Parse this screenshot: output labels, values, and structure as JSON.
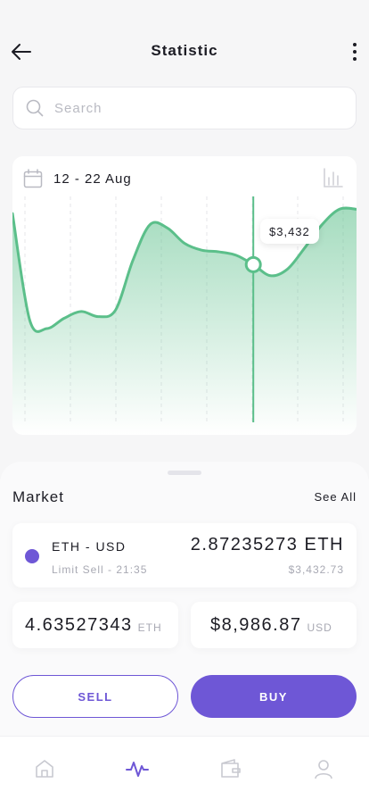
{
  "header": {
    "title": "Statistic"
  },
  "search": {
    "placeholder": "Search",
    "value": ""
  },
  "chart": {
    "date_range": "12 - 22 Aug",
    "tooltip": "$3,432",
    "accent": "#5bbf8a",
    "icons": {
      "calendar": "calendar-icon",
      "chart_type": "bar-chart-icon"
    }
  },
  "chart_data": {
    "type": "area",
    "x": [
      0,
      1,
      2,
      3,
      4,
      5,
      6,
      7,
      8,
      9,
      10,
      11,
      12,
      13,
      14,
      15,
      16,
      17,
      18,
      19,
      20
    ],
    "values": [
      245,
      120,
      110,
      122,
      130,
      124,
      132,
      190,
      232,
      228,
      210,
      202,
      200,
      196,
      185,
      172,
      180,
      205,
      232,
      250,
      250
    ],
    "highlight_index": 14,
    "ylim": [
      0,
      265
    ],
    "grid": "vertical-dashed",
    "title": "",
    "xlabel": "",
    "ylabel": ""
  },
  "market": {
    "title": "Market",
    "see_all": "See All",
    "pair": {
      "name": "ETH - USD",
      "sub": "Limit Sell - 21:35",
      "amount": "2.87235273 ETH",
      "usd": "$3,432.73",
      "dot_color": "#6e57d6"
    },
    "eth_balance": {
      "value": "4.63527343",
      "unit": "ETH"
    },
    "usd_balance": {
      "value": "$8,986.87",
      "unit": "USD"
    }
  },
  "actions": {
    "sell": "SELL",
    "buy": "BUY",
    "accent": "#6e57d6"
  },
  "tabs": [
    {
      "name": "home",
      "icon": "home-icon",
      "active": false
    },
    {
      "name": "statistic",
      "icon": "activity-icon",
      "active": true
    },
    {
      "name": "wallet",
      "icon": "wallet-icon",
      "active": false
    },
    {
      "name": "profile",
      "icon": "user-icon",
      "active": false
    }
  ]
}
